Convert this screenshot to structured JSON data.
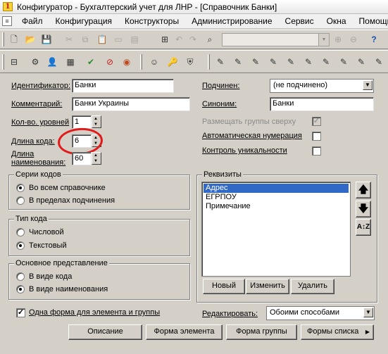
{
  "window": {
    "title": "Конфигуратор - Бухгалтерский учет для ЛНР - [Справочник Банки]"
  },
  "menu": [
    "Файл",
    "Конфигурация",
    "Конструкторы",
    "Администрирование",
    "Сервис",
    "Окна",
    "Помощь"
  ],
  "toolbar": {
    "search_value": ""
  },
  "form": {
    "identifier_label": "Идентификатор:",
    "identifier_value": "Банки",
    "comment_label": "Комментарий:",
    "comment_value": "Банки Украины",
    "levels_label": "Кол-во. уровней",
    "levels_value": "1",
    "code_length_label": "Длина кода:",
    "code_length_value": "6",
    "name_length_label_1": "Длина",
    "name_length_label_2": "наименования:",
    "name_length_value": "60",
    "subordinate_label": "Подчинен:",
    "subordinate_value": "(не подчинено)",
    "synonym_label": "Синоним:",
    "synonym_value": "Банки",
    "groups_top_label": "Размещать группы сверху",
    "groups_top_checked": true,
    "auto_numbering_label": "Автоматическая нумерация",
    "auto_numbering_checked": false,
    "uniqueness_label": "Контроль уникальности",
    "uniqueness_checked": false
  },
  "code_series": {
    "title": "Серии кодов",
    "options": [
      "Во всем справочнике",
      "В пределах подчинения"
    ],
    "selected": 0
  },
  "code_type": {
    "title": "Тип кода",
    "options": [
      "Числовой",
      "Текстовый"
    ],
    "selected": 1
  },
  "main_view": {
    "title": "Основное представление",
    "options": [
      "В виде кода",
      "В виде наименования"
    ],
    "selected": 1
  },
  "requisites": {
    "title": "Реквизиты",
    "items": [
      "Адрес",
      "ЕГРПОУ",
      "Примечание"
    ],
    "selected": 0,
    "new_label": "Новый",
    "edit_label": "Изменить",
    "delete_label": "Удалить"
  },
  "bottom": {
    "one_form_label": "Одна форма для элемента и группы",
    "one_form_checked": true,
    "edit_label": "Редактировать:",
    "edit_value": "Обоими способами",
    "buttons": [
      "Описание",
      "Форма элемента",
      "Форма группы",
      "Формы списка"
    ]
  },
  "annotation": {
    "color": "#e31a1a"
  }
}
